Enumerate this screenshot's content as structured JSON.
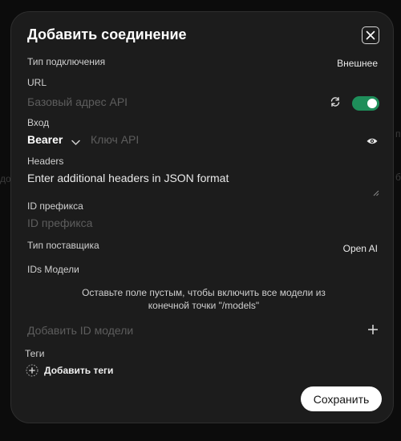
{
  "modal": {
    "title": "Добавить соединение",
    "connection_type": {
      "label": "Тип подключения",
      "value": "Внешнее"
    },
    "url": {
      "label": "URL",
      "placeholder": "Базовый адрес API",
      "enabled": true
    },
    "auth": {
      "label": "Вход",
      "method": "Bearer",
      "key_placeholder": "Ключ API"
    },
    "headers": {
      "label": "Headers",
      "value": "Enter additional headers in JSON format"
    },
    "prefix_id": {
      "label": "ID префикса",
      "placeholder": "ID префикса"
    },
    "provider_type": {
      "label": "Тип поставщика",
      "value": "Open AI"
    },
    "model_ids": {
      "label": "IDs Модели",
      "hint_line1": "Оставьте поле пустым, чтобы включить все модели из",
      "hint_line2": "конечной точки \"/models\"",
      "add_placeholder": "Добавить ID модели"
    },
    "tags": {
      "label": "Теги",
      "add_label": "Добавить теги"
    },
    "save_label": "Сохранить"
  },
  "background": {
    "left_text": "до",
    "right_text_1": "п",
    "right_text_2": "б"
  },
  "colors": {
    "accent_toggle": "#1e8e5a",
    "modal_bg": "#1c1c1c",
    "page_bg": "#0c0c0c"
  }
}
